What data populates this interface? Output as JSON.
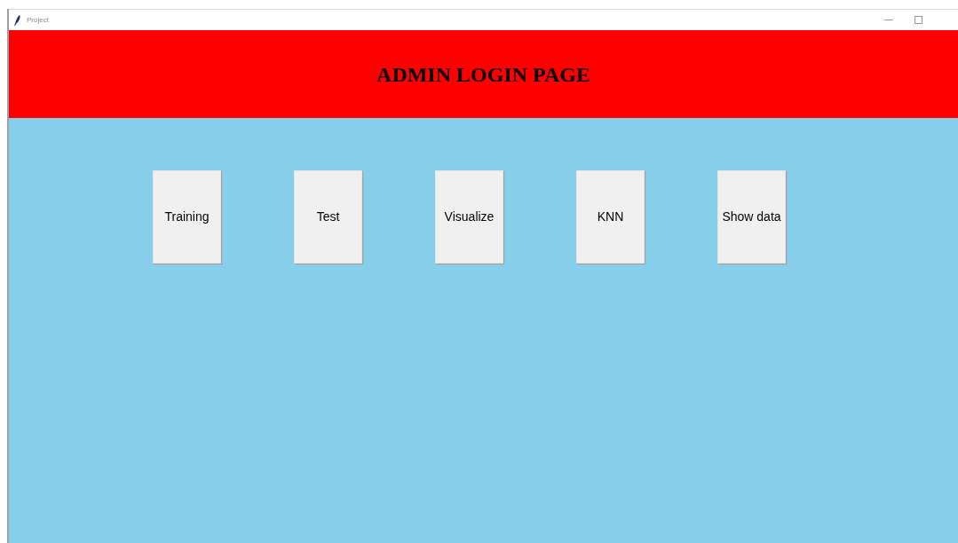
{
  "window": {
    "title": "Project"
  },
  "header": {
    "title": "ADMIN LOGIN PAGE"
  },
  "buttons": [
    "Training",
    "Test",
    "Visualize",
    "KNN",
    "Show data"
  ]
}
